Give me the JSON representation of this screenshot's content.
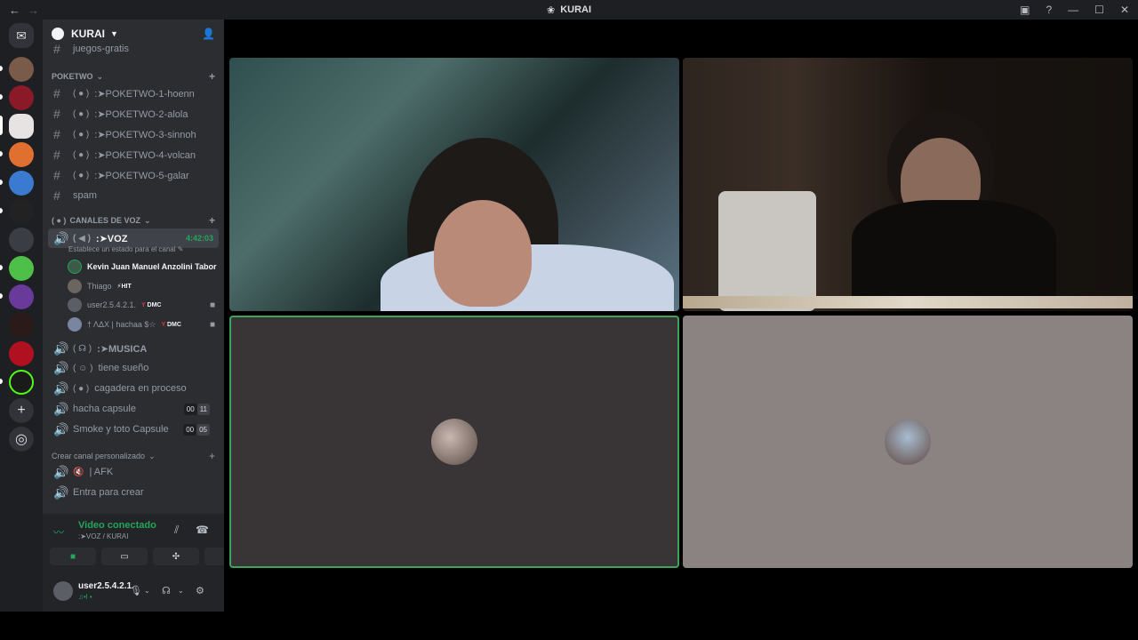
{
  "window": {
    "title": "KURAI",
    "back": "←",
    "forward": "→"
  },
  "guild": {
    "name": "KURAI",
    "partial_top_channel": "juegos-gratis"
  },
  "categories": {
    "poketwo": "POKETWO",
    "voz": "CANALES DE VOZ",
    "custom": "Crear canal personalizado"
  },
  "text_channels": [
    {
      "name": ":➤POKETWO-1-hoenn"
    },
    {
      "name": ":➤POKETWO-2-alola"
    },
    {
      "name": ":➤POKETWO-3-sinnoh"
    },
    {
      "name": ":➤POKETWO-4-volcan"
    },
    {
      "name": ":➤POKETWO-5-galar"
    },
    {
      "name": "spam"
    }
  ],
  "active_voice": {
    "name": ":➤VOZ",
    "timer": "4:42:03",
    "status_hint": "Establece un estado para el canal"
  },
  "members": [
    {
      "name": "Kevin Juan Manuel Anzolini Tabor",
      "tag": ""
    },
    {
      "name": "Thiago",
      "tag": "HIT"
    },
    {
      "name": "user2.5.4.2.1.",
      "tag": "DMC"
    },
    {
      "name": "† ΛΔX | hachaa $☆",
      "tag": "DMC"
    }
  ],
  "voice_channels": [
    {
      "name": ":➤MUSICA"
    },
    {
      "name": "tiene sueño"
    },
    {
      "name": "cagadera en proceso"
    },
    {
      "name": "hacha capsule",
      "count": [
        "00",
        "11"
      ]
    },
    {
      "name": "Smoke y toto Capsule",
      "count": [
        "00",
        "05"
      ]
    }
  ],
  "custom_channels": [
    {
      "name": "| AFK"
    },
    {
      "name": "Entra para crear"
    }
  ],
  "voice_panel": {
    "status": "Video conectado",
    "location": ":➤VOZ / KURAI"
  },
  "user": {
    "name": "user2.5.4.2.1.",
    "status": "♫•l • "
  },
  "icons": {
    "rail_home": "discord-icon",
    "gear": "gear-icon",
    "mic": "microphone-icon",
    "headphones": "headphones-icon"
  },
  "colors": {
    "connected_green": "#23a55a",
    "speaking_border": "#3ba55d",
    "sidebar_bg": "#2b2d31"
  }
}
